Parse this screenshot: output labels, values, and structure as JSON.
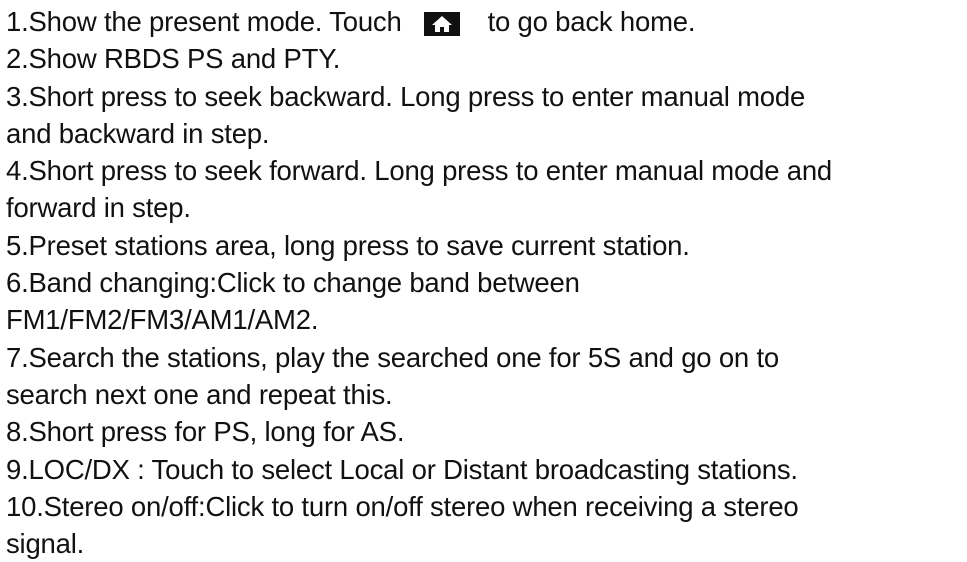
{
  "items": [
    {
      "lines": [
        {
          "before": "1.Show the present mode. Touch",
          "icon": "home-icon",
          "after": "to go back home."
        }
      ]
    },
    {
      "lines": [
        "2.Show RBDS PS and PTY."
      ]
    },
    {
      "lines": [
        "3.Short press to seek backward. Long press to enter manual mode",
        "and backward in step."
      ]
    },
    {
      "lines": [
        "4.Short press to seek forward. Long press to enter manual mode and",
        "forward in step."
      ]
    },
    {
      "lines": [
        "5.Preset stations area, long press to save current station."
      ]
    },
    {
      "lines": [
        "6.Band changing:Click to change band between",
        "FM1/FM2/FM3/AM1/AM2."
      ]
    },
    {
      "lines": [
        "7.Search the stations, play the searched one for 5S and go on to",
        "search next one and repeat this."
      ]
    },
    {
      "lines": [
        "8.Short press for PS, long for AS."
      ]
    },
    {
      "lines": [
        "9.LOC/DX : Touch to select Local or Distant broadcasting stations."
      ]
    },
    {
      "lines": [
        "10.Stereo on/off:Click to turn on/off stereo when receiving a stereo",
        "signal."
      ]
    }
  ],
  "colors": {
    "text": "#111111",
    "icon_background": "#111111",
    "icon_foreground": "#ffffff"
  }
}
